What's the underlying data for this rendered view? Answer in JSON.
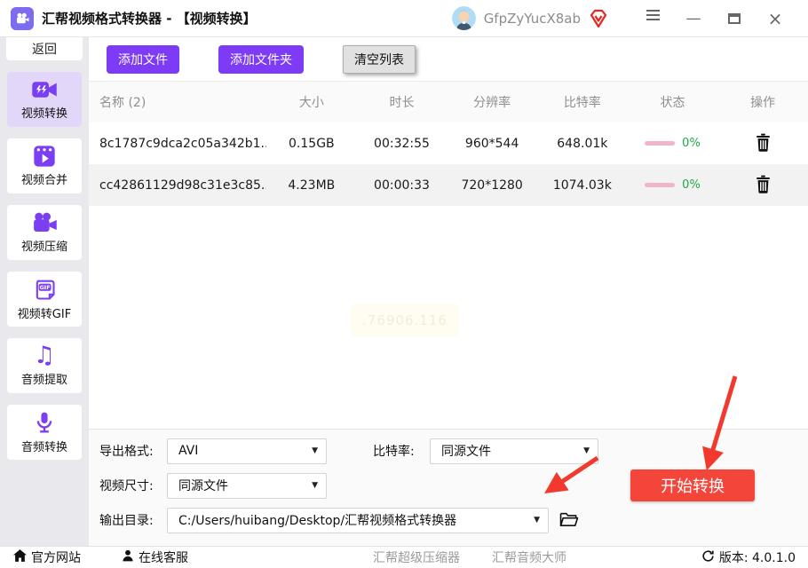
{
  "title_bar": {
    "app_title": "汇帮视频格式转换器 - 【视频转换】",
    "username": "GfpZyYucX8ab"
  },
  "sidebar": {
    "back_label": "返回",
    "items": [
      {
        "label": "视频转换",
        "active": true
      },
      {
        "label": "视频合并",
        "active": false
      },
      {
        "label": "视频压缩",
        "active": false
      },
      {
        "label": "视频转GIF",
        "active": false
      },
      {
        "label": "音频提取",
        "active": false
      },
      {
        "label": "音频转换",
        "active": false
      }
    ]
  },
  "toolbar": {
    "add_file": "添加文件",
    "add_folder": "添加文件夹",
    "clear_list": "清空列表"
  },
  "table": {
    "headers": [
      "名称 (2)",
      "大小",
      "时长",
      "分辨率",
      "比特率",
      "状态",
      "操作"
    ],
    "rows": [
      {
        "name": "8c1787c9dca2c05a342b1...",
        "size": "0.15GB",
        "duration": "00:32:55",
        "resolution": "960*544",
        "bitrate": "648.01k",
        "progress": "0%"
      },
      {
        "name": "cc42861129d98c31e3c85...",
        "size": "4.23MB",
        "duration": "00:00:33",
        "resolution": "720*1280",
        "bitrate": "1074.03k",
        "progress": "0%"
      }
    ]
  },
  "faint_toast_text": ".76906.116",
  "settings": {
    "export_format_label": "导出格式:",
    "export_format_value": "AVI",
    "bitrate_label": "比特率:",
    "bitrate_value": "同源文件",
    "video_size_label": "视频尺寸:",
    "video_size_value": "同源文件",
    "output_dir_label": "输出目录:",
    "output_dir_value": "C:/Users/huibang/Desktop/汇帮视频格式转换器",
    "start_button": "开始转换",
    "caret": "▼"
  },
  "status_bar": {
    "official_site": "官方网站",
    "online_service": "在线客服",
    "link_compressor": "汇帮超级压缩器",
    "link_audio": "汇帮音频大师",
    "version_text": "版本:  4.0.1.0"
  },
  "colors": {
    "accent_purple": "#7d3bf5",
    "sidebar_active_bg": "#e3d7f9",
    "start_red": "#f4453a",
    "arrow_red": "#f3392e",
    "progress_pink": "#f0b6c8",
    "percent_green": "#21a84a"
  }
}
